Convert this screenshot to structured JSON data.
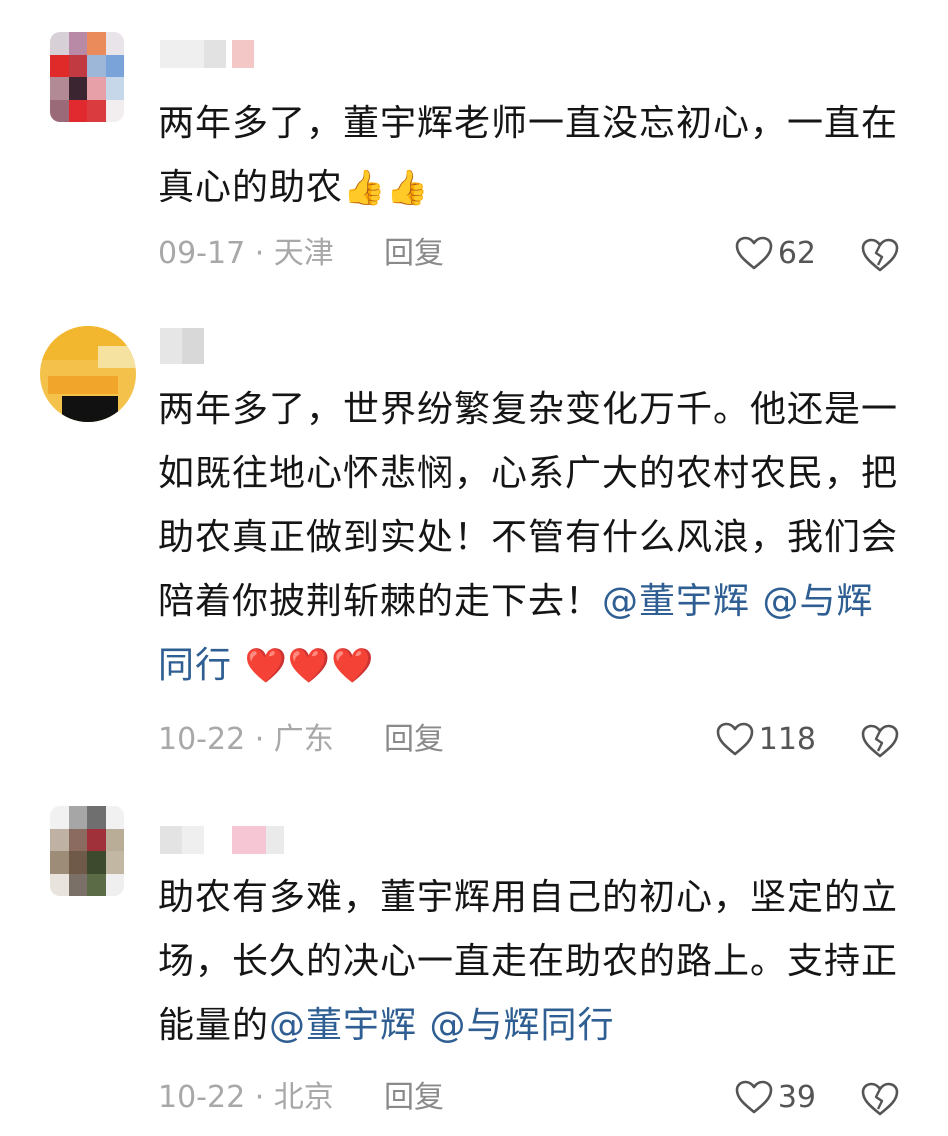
{
  "comments": [
    {
      "text_parts": [
        {
          "type": "text",
          "value": "两年多了，董宇辉老师一直没忘初心，一直在真心的助农"
        },
        {
          "type": "emoji",
          "value": "👍👍"
        }
      ],
      "date": "09-17",
      "location": "天津",
      "reply_label": "回复",
      "likes": "62"
    },
    {
      "text_parts": [
        {
          "type": "text",
          "value": "两年多了，世界纷繁复杂变化万千。他还是一如既往地心怀悲悯，心系广大的农村农民，把助农真正做到实处！不管有什么风浪，我们会陪着你披荆斩棘的走下去！"
        },
        {
          "type": "mention",
          "value": "@董宇辉"
        },
        {
          "type": "text",
          "value": " "
        },
        {
          "type": "mention",
          "value": "@与辉同行"
        },
        {
          "type": "text",
          "value": " "
        },
        {
          "type": "emoji",
          "value": "❤️❤️❤️"
        }
      ],
      "date": "10-22",
      "location": "广东",
      "reply_label": "回复",
      "likes": "118"
    },
    {
      "text_parts": [
        {
          "type": "text",
          "value": "助农有多难，董宇辉用自己的初心，坚定的立场，长久的决心一直走在助农的路上。支持正能量的"
        },
        {
          "type": "mention",
          "value": "@董宇辉"
        },
        {
          "type": "text",
          "value": " "
        },
        {
          "type": "mention",
          "value": "@与辉同行"
        }
      ],
      "date": "10-22",
      "location": "北京",
      "reply_label": "回复",
      "likes": "39"
    }
  ],
  "meta_separator": " · ",
  "icons": {
    "like": "heart-outline-icon",
    "dislike": "broken-heart-icon"
  },
  "colors": {
    "text": "#151515",
    "mention": "#2e5e92",
    "meta": "#a8a8a8",
    "icon": "#555555"
  }
}
